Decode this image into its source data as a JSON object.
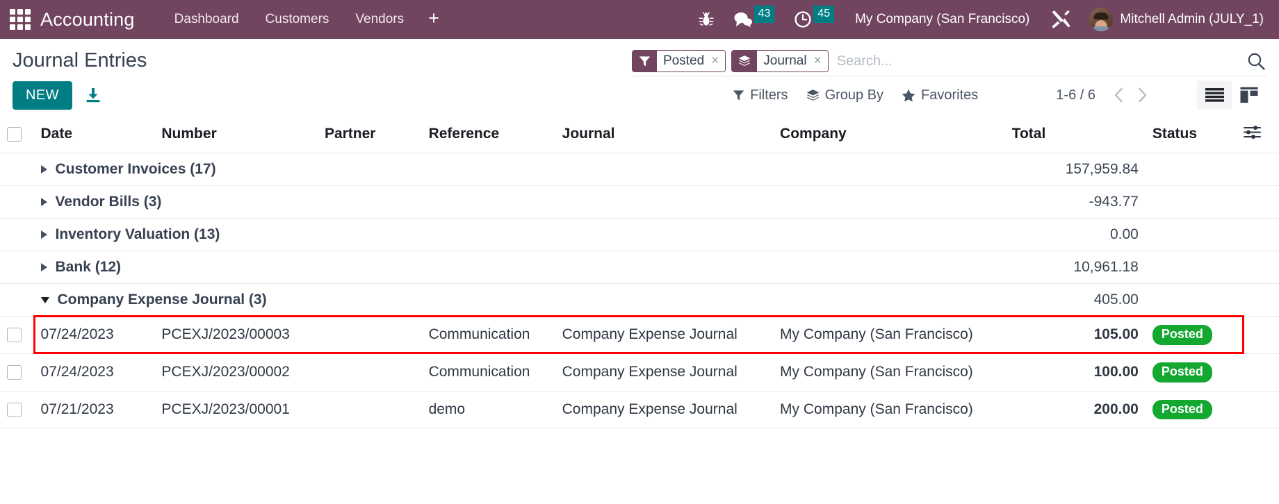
{
  "navbar": {
    "apps_icon": "apps-grid-icon",
    "brand": "Accounting",
    "menu": [
      {
        "label": "Dashboard"
      },
      {
        "label": "Customers"
      },
      {
        "label": "Vendors"
      }
    ],
    "plus_label": "+",
    "bug_icon": "bug-icon",
    "messages": {
      "icon": "chat-icon",
      "count": "43"
    },
    "activities": {
      "icon": "clock-icon",
      "count": "45"
    },
    "company": "My Company (San Francisco)",
    "debug_icon": "tools-icon",
    "user": "Mitchell Admin (JULY_1)",
    "accent": "#71445f",
    "badge_color": "#017e84"
  },
  "control_panel": {
    "title": "Journal Entries",
    "new_label": "NEW",
    "import_icon": "download-import-icon",
    "search": {
      "placeholder": "Search...",
      "facets": [
        {
          "icon": "filter-funnel-icon",
          "label": "Posted",
          "close": "×"
        },
        {
          "icon": "layers-group-icon",
          "label": "Journal",
          "close": "×"
        }
      ],
      "search_icon": "search-icon"
    },
    "dropdowns": [
      {
        "icon": "filter-funnel-icon",
        "label": "Filters"
      },
      {
        "icon": "layers-group-icon",
        "label": "Group By"
      },
      {
        "icon": "star-icon",
        "label": "Favorites"
      }
    ],
    "pager": {
      "range": "1-6 / 6",
      "prev_icon": "chevron-left-icon",
      "next_icon": "chevron-right-icon"
    },
    "views": [
      {
        "icon": "list-view-icon",
        "active": true
      },
      {
        "icon": "kanban-view-icon",
        "active": false
      }
    ]
  },
  "table": {
    "columns": [
      "Date",
      "Number",
      "Partner",
      "Reference",
      "Journal",
      "Company",
      "Total",
      "Status"
    ],
    "optional_columns_icon": "column-settings-icon",
    "groups": [
      {
        "label": "Customer Invoices (17)",
        "total": "157,959.84",
        "expanded": false
      },
      {
        "label": "Vendor Bills (3)",
        "total": "-943.77",
        "expanded": false
      },
      {
        "label": "Inventory Valuation (13)",
        "total": "0.00",
        "expanded": false
      },
      {
        "label": "Bank (12)",
        "total": "10,961.18",
        "expanded": false
      },
      {
        "label": "Company Expense Journal (3)",
        "total": "405.00",
        "expanded": true
      }
    ],
    "rows": [
      {
        "date": "07/24/2023",
        "number": "PCEXJ/2023/00003",
        "partner": "",
        "reference": "Communication",
        "journal": "Company Expense Journal",
        "company": "My Company (San Francisco)",
        "total": "105.00",
        "status": "Posted",
        "highlighted": true
      },
      {
        "date": "07/24/2023",
        "number": "PCEXJ/2023/00002",
        "partner": "",
        "reference": "Communication",
        "journal": "Company Expense Journal",
        "company": "My Company (San Francisco)",
        "total": "100.00",
        "status": "Posted",
        "highlighted": false
      },
      {
        "date": "07/21/2023",
        "number": "PCEXJ/2023/00001",
        "partner": "",
        "reference": "demo",
        "journal": "Company Expense Journal",
        "company": "My Company (San Francisco)",
        "total": "200.00",
        "status": "Posted",
        "highlighted": false
      }
    ]
  },
  "colors": {
    "brand_purple": "#71445f",
    "teal": "#017e84",
    "posted_green": "#14a831",
    "highlight_red": "#ff0000"
  }
}
